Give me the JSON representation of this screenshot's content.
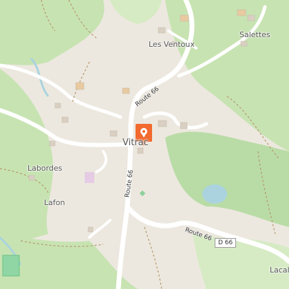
{
  "map": {
    "places": [
      {
        "id": "les-ventoux",
        "label": "Les Ventoux"
      },
      {
        "id": "salettes",
        "label": "Salettes"
      },
      {
        "id": "vitrac",
        "label": "Vitrac"
      },
      {
        "id": "labordes",
        "label": "Labordes"
      },
      {
        "id": "lafon",
        "label": "Lafon"
      },
      {
        "id": "lacal",
        "label": "Lacal"
      }
    ],
    "roads": [
      {
        "id": "route66-north",
        "label": "Route 66"
      },
      {
        "id": "route66-west",
        "label": "Route 66"
      },
      {
        "id": "route66-east",
        "label": "Route 66"
      }
    ],
    "shield": {
      "label": "D 66"
    },
    "marker": {
      "label": "location-pin",
      "color": "#f26a2e"
    },
    "colors": {
      "land": "#ece8df",
      "forest": "#c7e3b2",
      "forest_dark": "#a9d59a",
      "road": "#ffffff",
      "water": "#aad3df",
      "marker": "#f26a2e"
    }
  }
}
